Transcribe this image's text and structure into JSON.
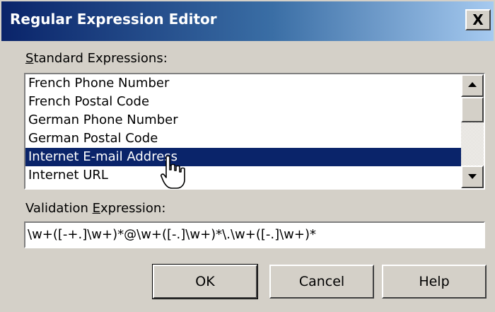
{
  "window": {
    "title": "Regular Expression Editor",
    "close_glyph": "X"
  },
  "standard": {
    "label_access": "S",
    "label_rest": "tandard Expressions:",
    "items": [
      {
        "label": "French Phone Number"
      },
      {
        "label": "French Postal Code"
      },
      {
        "label": "German Phone Number"
      },
      {
        "label": "German Postal Code"
      },
      {
        "label": "Internet E-mail Address",
        "selected": true
      },
      {
        "label": "Internet URL"
      }
    ]
  },
  "validation": {
    "label_before": "Validation ",
    "label_access": "E",
    "label_after": "xpression:",
    "value": "\\w+([-+.]\\w+)*@\\w+([-.]\\w+)*\\.\\w+([-.]\\w+)*"
  },
  "buttons": {
    "ok": "OK",
    "cancel": "Cancel",
    "help": "Help"
  },
  "colors": {
    "face": "#d4d0c8",
    "selection": "#0a246a",
    "titlebar_start": "#0a246a",
    "titlebar_end": "#a6caf0"
  },
  "icons": {
    "cursor": "hand-pointer-icon",
    "scroll_up": "arrow-up-icon",
    "scroll_down": "arrow-down-icon"
  }
}
